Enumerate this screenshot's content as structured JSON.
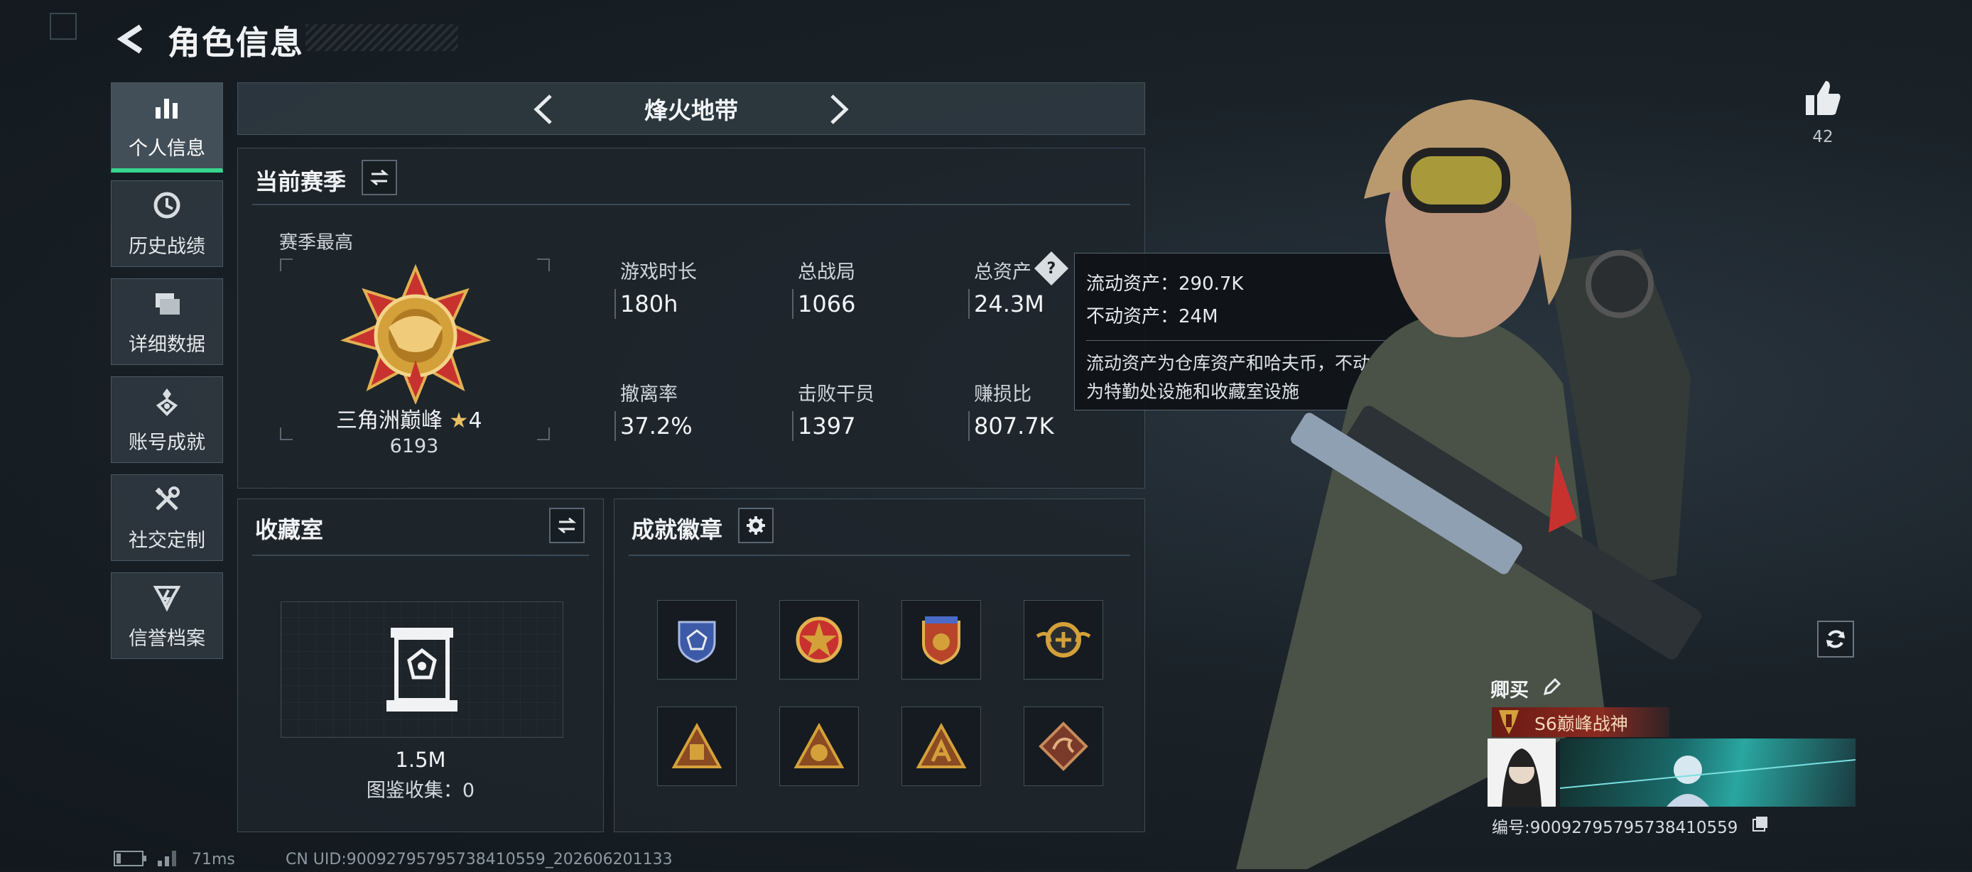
{
  "header": {
    "title": "角色信息"
  },
  "sidebar": {
    "items": [
      {
        "label": "个人信息",
        "icon": "bar-chart-icon",
        "active": true
      },
      {
        "label": "历史战绩",
        "icon": "clock-icon"
      },
      {
        "label": "详细数据",
        "icon": "folder-icon"
      },
      {
        "label": "账号成就",
        "icon": "achievement-icon"
      },
      {
        "label": "社交定制",
        "icon": "tools-icon"
      },
      {
        "label": "信誉档案",
        "icon": "shield-icon"
      }
    ]
  },
  "mode": {
    "label": "烽火地带"
  },
  "season": {
    "title": "当前赛季",
    "best_label": "赛季最高",
    "rank_name": "三角洲巅峰",
    "rank_stars": "4",
    "rank_score": "6193",
    "stats": [
      {
        "label": "游戏时长",
        "value": "180h"
      },
      {
        "label": "总战局",
        "value": "1066"
      },
      {
        "label": "总资产",
        "value": "24.3M"
      },
      {
        "label": "撤离率",
        "value": "37.2%"
      },
      {
        "label": "击败干员",
        "value": "1397"
      },
      {
        "label": "赚损比",
        "value": "807.7K"
      }
    ]
  },
  "tooltip": {
    "liquid": "流动资产：290.7K",
    "fixed": "不动资产：24M",
    "desc_line1": "流动资产为仓库资产和哈夫币，不动资产",
    "desc_line2": "为特勤处设施和收藏室设施"
  },
  "collection": {
    "title": "收藏室",
    "value": "1.5M",
    "catalog": "图鉴收集：0"
  },
  "badges": {
    "title": "成就徽章",
    "items": [
      "badge-shield-blue",
      "badge-star-red",
      "badge-shield-orange",
      "badge-wing-gold",
      "badge-triangle-1",
      "badge-triangle-2",
      "badge-triangle-3",
      "badge-dragon"
    ]
  },
  "likes": {
    "count": "42"
  },
  "player": {
    "name": "卿买",
    "title": "S6巅峰战神",
    "id": "编号:9009279579573841055​9"
  },
  "footer": {
    "ping": "71ms",
    "uid": "CN UID:900927957957384105​59_20260620113​3"
  },
  "colors": {
    "accent": "#35d68e",
    "panel_bg": "#1e262c",
    "gold": "#d4a03a"
  }
}
